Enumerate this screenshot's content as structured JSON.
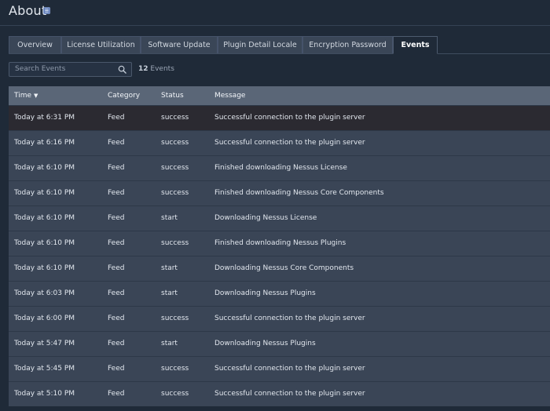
{
  "page": {
    "title": "About"
  },
  "tabs": [
    {
      "label": "Overview",
      "active": false
    },
    {
      "label": "License Utilization",
      "active": false
    },
    {
      "label": "Software Update",
      "active": false
    },
    {
      "label": "Plugin Detail Locale",
      "active": false
    },
    {
      "label": "Encryption Password",
      "active": false
    },
    {
      "label": "Events",
      "active": true
    }
  ],
  "search": {
    "placeholder": "Search Events"
  },
  "events_count": {
    "number": "12",
    "label": "Events"
  },
  "table": {
    "columns": [
      "Time",
      "Category",
      "Status",
      "Message"
    ],
    "sort_column": "Time",
    "sort_direction": "descending",
    "rows": [
      {
        "time": "Today at 6:31 PM",
        "category": "Feed",
        "status": "success",
        "message": "Successful connection to the plugin server"
      },
      {
        "time": "Today at 6:16 PM",
        "category": "Feed",
        "status": "success",
        "message": "Successful connection to the plugin server"
      },
      {
        "time": "Today at 6:10 PM",
        "category": "Feed",
        "status": "success",
        "message": "Finished downloading Nessus License"
      },
      {
        "time": "Today at 6:10 PM",
        "category": "Feed",
        "status": "success",
        "message": "Finished downloading Nessus Core Components"
      },
      {
        "time": "Today at 6:10 PM",
        "category": "Feed",
        "status": "start",
        "message": "Downloading Nessus License"
      },
      {
        "time": "Today at 6:10 PM",
        "category": "Feed",
        "status": "success",
        "message": "Finished downloading Nessus Plugins"
      },
      {
        "time": "Today at 6:10 PM",
        "category": "Feed",
        "status": "start",
        "message": "Downloading Nessus Core Components"
      },
      {
        "time": "Today at 6:03 PM",
        "category": "Feed",
        "status": "start",
        "message": "Downloading Nessus Plugins"
      },
      {
        "time": "Today at 6:00 PM",
        "category": "Feed",
        "status": "success",
        "message": "Successful connection to the plugin server"
      },
      {
        "time": "Today at 5:47 PM",
        "category": "Feed",
        "status": "start",
        "message": "Downloading Nessus Plugins"
      },
      {
        "time": "Today at 5:45 PM",
        "category": "Feed",
        "status": "success",
        "message": "Successful connection to the plugin server"
      },
      {
        "time": "Today at 5:10 PM",
        "category": "Feed",
        "status": "success",
        "message": "Successful connection to the plugin server"
      }
    ]
  },
  "colors": {
    "background": "#1f2a38",
    "header_row": "#5a6677",
    "row": "#3a4556",
    "hover_row": "#2b2a31"
  }
}
